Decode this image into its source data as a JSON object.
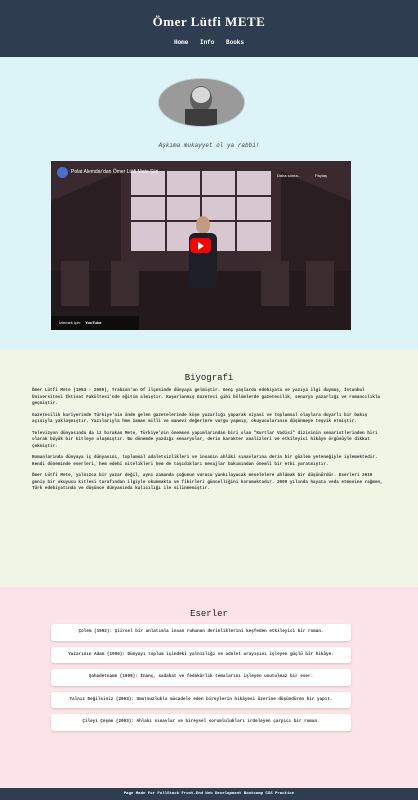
{
  "header": {
    "title": "Ömer Lütfi METE",
    "nav": [
      "Home",
      "Info",
      "Books"
    ]
  },
  "intro": {
    "quote": "Aşkıma mukayyet ol ya rabbi!",
    "video": {
      "title": "Polat Alemdar'dan Ömer Lütfi Mete Şiiri",
      "later": "Daha sonra...",
      "share": "Paylaş",
      "watch": "İzlemek için:",
      "brand": "YouTube"
    }
  },
  "bio": {
    "heading": "Biyografi",
    "paragraphs": [
      "Ömer Lütfi Mete (1953 - 2009), Trabzon'un Of ilçesinde dünyaya gelmiştir. Genç yaşlarda edebiyata ve yazıya ilgi duymuş, İstanbul Üniversitesi İktisat Fakültesi'nde eğitim almıştır. Kaşarlanmış Gazeteci gibi bölümlerde gazetecilik, senaryo yazarlığı ve romancılıkla geçmiştir.",
      "Gazetecilik kariyerinde Türkiye'nin önde gelen gazetelerinde köşe yazarlığı yaparak siyasi ve toplumsal olaylara duyarlı bir bakış açısıyla yaklaşmıştır. Yazılarıyla hem zaman milli ve manevi değerlere vurgu yapmış, okuyucularının düşünmeye teşvik etmiştir.",
      "Televizyon dünyasında da iz bırakan Mete, Türkiye'nin önemsen yapımlarından biri olan \"Kurtlar Vadisi\" dizisinin senaristlerinden biri olarak büyük bir kitleye ulaşmıştır. Bu dönemde yazdığı senaryolar, derin karakter analizleri ve etkileyici hikâye örgüsüyle dikkat çekmiştir.",
      "Romanlarında dünyaya iç dünyasını, toplumsal adaletsizlikleri ve insanın ahlâki sınavlarına derin bir gözlem yeteneğiyle işlemektedir. Kendi döneminde eserleri, hem edebi nitelikleri hem de taşıdıkları mesajlar bakımından önemli bir etki yaratmıştır.",
      "Ömer Lütfi Mete, yalnızca bir yazar değil, aynı zamanda çoğunun vurucu yankılayacak meselelere ahlâmak bir düşünürdür. Eserleri 2019 geniş bir okuyucu kitlesi tarafından ilgiyle okunmakta ve fikirleri güncelliğini korumaktadır. 2009 yılında hayata veda etmesine rağmen, Türk edebiyatında ve düşünce dünyasında kalıcılığı ile silinmemiştir."
    ]
  },
  "works": {
    "heading": "Eserler",
    "items": [
      "Çolem (1992): Şiirsel bir anlatımla insan ruhunun derinliklerini keşfeden etkileyici bir roman.",
      "Yazarının Adam (1996): Dünyayı toplum içindeki yalnızlığı ve adalet arayışını işleyen güçlü bir hikâye.",
      "Şahadetname (1998): İnanç, sadakat ve fedakârlık temalarını işleyen unutulmaz bir eser.",
      "Yalnız Değilsiniz (2003): Umutsuzlukla mücadele eden bireylerin hikâyesi üzerine düşündüren bir yapıt.",
      "Çileyi Çeşme (2003): Ahlaki sınavlar ve bireysel sorumlulukları irdeleyen çarpıcı bir roman."
    ]
  },
  "footer": {
    "text": "Page Made For FullStack Front-End Web Development Bootcamp CSS Practice"
  }
}
